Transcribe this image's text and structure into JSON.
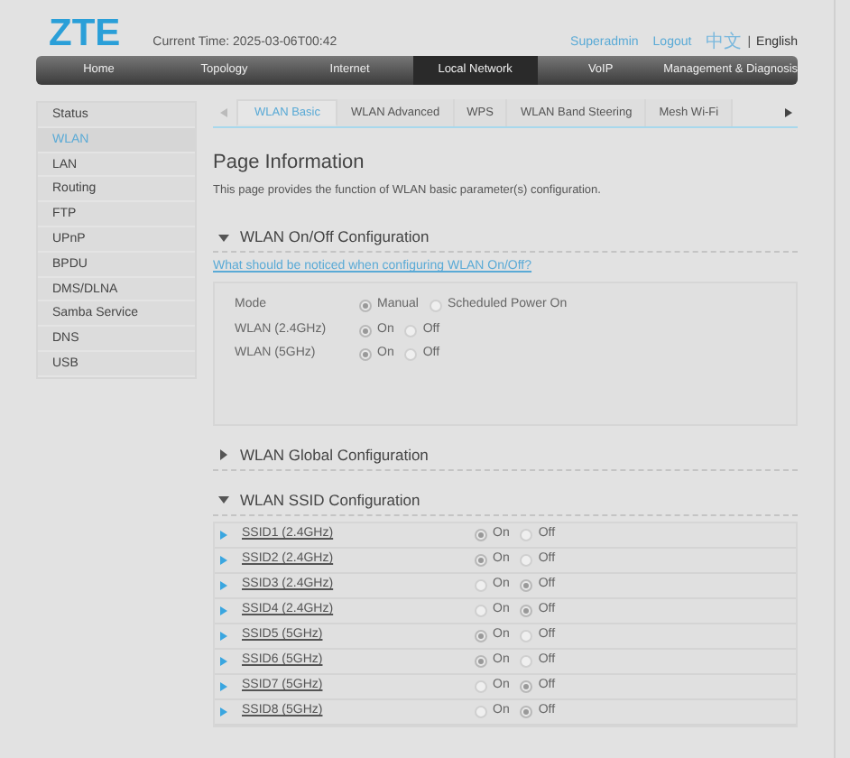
{
  "header": {
    "logo": "ZTE",
    "current_time": "Current Time: 2025-03-06T00:42",
    "user": "Superadmin",
    "logout": "Logout",
    "language_separator": "|",
    "languages": [
      {
        "label": "中文",
        "selected": false
      },
      {
        "label": "English",
        "selected": true
      }
    ]
  },
  "nav": [
    {
      "label": "Home",
      "selected": false
    },
    {
      "label": "Topology",
      "selected": false
    },
    {
      "label": "Internet",
      "selected": false
    },
    {
      "label": "Local Network",
      "selected": true
    },
    {
      "label": "VoIP",
      "selected": false
    },
    {
      "label": "Management & Diagnosis",
      "selected": false
    }
  ],
  "sidebar": {
    "items": [
      {
        "label": "Status",
        "selected": false
      },
      {
        "label": "WLAN",
        "selected": true
      },
      {
        "label": "LAN",
        "selected": false
      },
      {
        "label": "Routing",
        "selected": false
      },
      {
        "label": "FTP",
        "selected": false
      },
      {
        "label": "UPnP",
        "selected": false
      },
      {
        "label": "BPDU",
        "selected": false
      },
      {
        "label": "DMS/DLNA",
        "selected": false
      },
      {
        "label": "Samba Service",
        "selected": false
      },
      {
        "label": "DNS",
        "selected": false
      },
      {
        "label": "USB",
        "selected": false
      }
    ]
  },
  "tabs": [
    {
      "label": "WLAN Basic",
      "selected": true
    },
    {
      "label": "WLAN Advanced",
      "selected": false
    },
    {
      "label": "WPS",
      "selected": false
    },
    {
      "label": "WLAN Band Steering",
      "selected": false
    },
    {
      "label": "Mesh Wi-Fi",
      "selected": false
    }
  ],
  "page_info": {
    "title": "Page Information",
    "description": "This page provides the function of WLAN basic parameter(s) configuration."
  },
  "sections": [
    {
      "kind": "settings",
      "title": "WLAN On/Off Configuration",
      "expanded": true,
      "link": "What should be noticed when configuring WLAN On/Off?",
      "settings": [
        {
          "label": "Mode",
          "options": [
            {
              "label": "Manual",
              "selected": true
            },
            {
              "label": "Scheduled Power On",
              "selected": false
            }
          ]
        },
        {
          "label": "WLAN (2.4GHz)",
          "options": [
            {
              "label": "On",
              "selected": true
            },
            {
              "label": "Off",
              "selected": false
            }
          ]
        },
        {
          "label": "WLAN (5GHz)",
          "options": [
            {
              "label": "On",
              "selected": true
            },
            {
              "label": "Off",
              "selected": false
            }
          ]
        }
      ]
    },
    {
      "title": "WLAN Global Configuration",
      "expanded": false
    },
    {
      "kind": "ssids",
      "title": "WLAN SSID Configuration",
      "expanded": true,
      "ssids": [
        {
          "name": "SSID1 (2.4GHz)",
          "options": [
            {
              "label": "On",
              "selected": true
            },
            {
              "label": "Off",
              "selected": false
            }
          ]
        },
        {
          "name": "SSID2 (2.4GHz)",
          "options": [
            {
              "label": "On",
              "selected": true
            },
            {
              "label": "Off",
              "selected": false
            }
          ]
        },
        {
          "name": "SSID3 (2.4GHz)",
          "options": [
            {
              "label": "On",
              "selected": false
            },
            {
              "label": "Off",
              "selected": true
            }
          ]
        },
        {
          "name": "SSID4 (2.4GHz)",
          "options": [
            {
              "label": "On",
              "selected": false
            },
            {
              "label": "Off",
              "selected": true
            }
          ]
        },
        {
          "name": "SSID5 (5GHz)",
          "options": [
            {
              "label": "On",
              "selected": true
            },
            {
              "label": "Off",
              "selected": false
            }
          ]
        },
        {
          "name": "SSID6 (5GHz)",
          "options": [
            {
              "label": "On",
              "selected": true
            },
            {
              "label": "Off",
              "selected": false
            }
          ]
        },
        {
          "name": "SSID7 (5GHz)",
          "options": [
            {
              "label": "On",
              "selected": false
            },
            {
              "label": "Off",
              "selected": true
            }
          ]
        },
        {
          "name": "SSID8 (5GHz)",
          "options": [
            {
              "label": "On",
              "selected": false
            },
            {
              "label": "Off",
              "selected": true
            }
          ]
        }
      ]
    }
  ]
}
